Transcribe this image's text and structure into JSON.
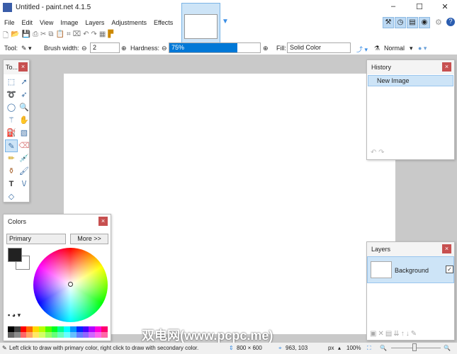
{
  "window": {
    "title": "Untitled - paint.net 4.1.5",
    "minimize": "–",
    "maximize": "☐",
    "close": "✕"
  },
  "menu": [
    "File",
    "Edit",
    "View",
    "Image",
    "Layers",
    "Adjustments",
    "Effects"
  ],
  "tool_options": {
    "tool_label": "Tool:",
    "brush_width_label": "Brush width:",
    "brush_width": "2",
    "hardness_label": "Hardness:",
    "hardness": "75%",
    "hardness_value": 0.75,
    "fill_label": "Fill:",
    "fill": "Solid Color",
    "blend": "Normal"
  },
  "tools_window": {
    "title": "To...",
    "icons": [
      "rectangle-select",
      "move-selection",
      "lasso",
      "move-selected",
      "ellipse-select",
      "zoom",
      "magic-wand",
      "pan",
      "paint-bucket",
      "gradient",
      "paintbrush",
      "eraser",
      "pencil",
      "color-picker",
      "clone-stamp",
      "recolor",
      "text",
      "line-curve",
      "shapes"
    ]
  },
  "history": {
    "title": "History",
    "items": [
      "New Image"
    ]
  },
  "colors": {
    "title": "Colors",
    "mode": "Primary",
    "more": "More >>",
    "primary": "#222222",
    "secondary": "#ffffff",
    "palette": [
      "#000000",
      "#404040",
      "#ff0000",
      "#ff6a00",
      "#ffd800",
      "#b6ff00",
      "#4cff00",
      "#00ff21",
      "#00ff90",
      "#00ffff",
      "#0094ff",
      "#0026ff",
      "#4800ff",
      "#b200ff",
      "#ff00dc",
      "#ff006e"
    ]
  },
  "layers": {
    "title": "Layers",
    "items": [
      {
        "name": "Background",
        "visible": true
      }
    ]
  },
  "status": {
    "hint": "Left click to draw with primary color, right click to draw with secondary color.",
    "size": "800 × 600",
    "cursor": "963, 103",
    "unit": "px",
    "zoom": "100%"
  },
  "watermark": "双电网(www.pcpc.me)"
}
